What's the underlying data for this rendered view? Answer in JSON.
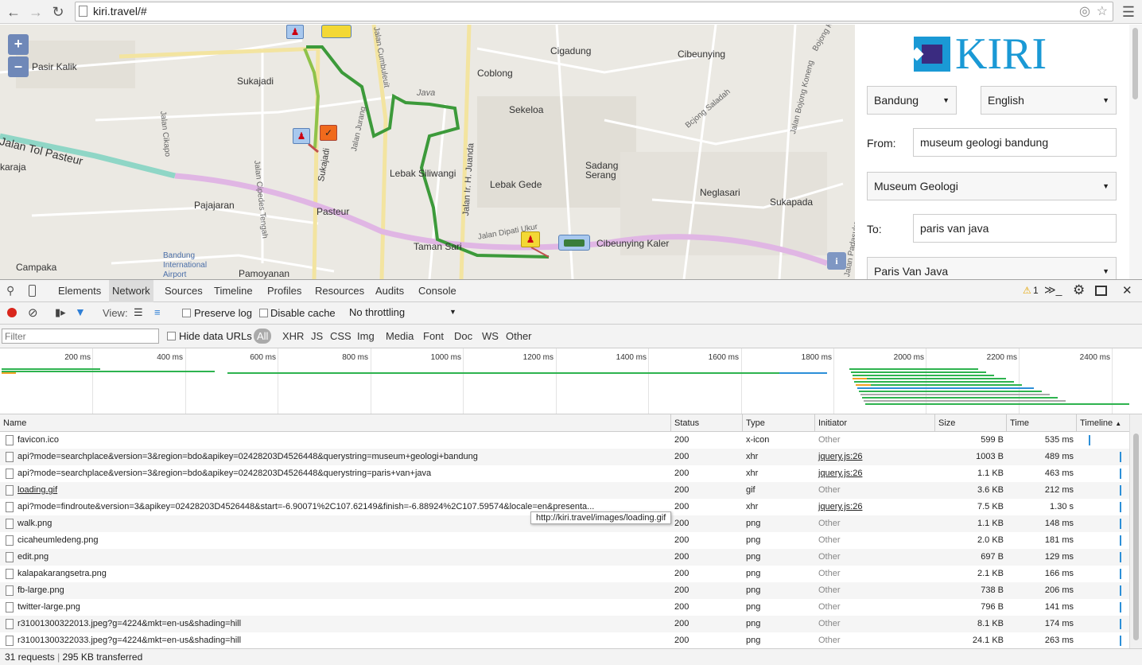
{
  "browser": {
    "url": "kiri.travel/#"
  },
  "map": {
    "labels": [
      {
        "text": "Pasir Kalik"
      },
      {
        "text": "Sukajadi"
      },
      {
        "text": "Cigadung"
      },
      {
        "text": "Cibeunying"
      },
      {
        "text": "Coblong"
      },
      {
        "text": "Sekeloa"
      },
      {
        "text": "Java"
      },
      {
        "text": "Jalan Tol Pasteur"
      },
      {
        "text": "karaja"
      },
      {
        "text": "Lebak Siliwangi"
      },
      {
        "text": "Lebak Gede"
      },
      {
        "text": "Sadang"
      },
      {
        "text": "Serang"
      },
      {
        "text": "Neglasari"
      },
      {
        "text": "Sukapada"
      },
      {
        "text": "Pajajaran"
      },
      {
        "text": "Pasteur"
      },
      {
        "text": "Cibeunying Kaler"
      },
      {
        "text": "Campaka"
      },
      {
        "text": "Bandung"
      },
      {
        "text": "International"
      },
      {
        "text": "Airport"
      },
      {
        "text": "Taman Sari"
      },
      {
        "text": "Pamoyanan"
      }
    ],
    "street_labels": [
      "Jalan Cumbuleuit",
      "Jalan Jurang",
      "Sukajadi",
      "Jalan Cipedes Tengah",
      "Jalan Cikapo",
      "Jalan Ir. H. Juanda",
      "Jalan Dipati Ukur",
      "Bojong Koneng",
      "Jalan Bojong Koneng",
      "Bcjong Saladah",
      "Jalan Padasuka"
    ],
    "zoom_in": "+",
    "zoom_out": "–",
    "info_icon": "i",
    "colors": {
      "route_green": "#3c9a3a",
      "route_lightgreen": "#8fc24a",
      "toll_road": "#8fd6c6",
      "main_road": "#e2b8e6",
      "minor_road": "#ffffff",
      "yellow_road": "#f6e7a2"
    }
  },
  "panel": {
    "logo_text": "KIRI",
    "city": "Bandung",
    "language": "English",
    "from_label": "From:",
    "from_value": "museum geologi bandung",
    "from_result": "Museum Geologi",
    "to_label": "To:",
    "to_value": "paris van java",
    "to_result": "Paris Van Java",
    "brand_color": "#1a99d5",
    "logo_dark": "#3a2b80"
  },
  "devtools": {
    "tabs": [
      "Elements",
      "Network",
      "Sources",
      "Timeline",
      "Profiles",
      "Resources",
      "Audits",
      "Console"
    ],
    "active_tab": "Network",
    "warning_count": "1",
    "view_label": "View:",
    "preserve_log": "Preserve log",
    "disable_cache": "Disable cache",
    "throttling": "No throttling",
    "filter_placeholder": "Filter",
    "hide_data_urls": "Hide data URLs",
    "types": [
      "All",
      "XHR",
      "JS",
      "CSS",
      "Img",
      "Media",
      "Font",
      "Doc",
      "WS",
      "Other"
    ],
    "ticks": [
      "200 ms",
      "400 ms",
      "600 ms",
      "800 ms",
      "1000 ms",
      "1200 ms",
      "1400 ms",
      "1600 ms",
      "1800 ms",
      "2000 ms",
      "2200 ms",
      "2400 ms"
    ],
    "columns": [
      "Name",
      "Status",
      "Type",
      "Initiator",
      "Size",
      "Time",
      "Timeline"
    ],
    "rows": [
      {
        "name": "favicon.ico",
        "status": "200",
        "type": "x-icon",
        "initiator": "Other",
        "size": "599 B",
        "time": "535 ms"
      },
      {
        "name": "api?mode=searchplace&version=3&region=bdo&apikey=02428203D4526448&querystring=museum+geologi+bandung",
        "status": "200",
        "type": "xhr",
        "initiator": "jquery.js:26",
        "size": "1003 B",
        "time": "489 ms"
      },
      {
        "name": "api?mode=searchplace&version=3&region=bdo&apikey=02428203D4526448&querystring=paris+van+java",
        "status": "200",
        "type": "xhr",
        "initiator": "jquery.js:26",
        "size": "1.1 KB",
        "time": "463 ms"
      },
      {
        "name": "loading.gif",
        "status": "200",
        "type": "gif",
        "initiator": "Other",
        "size": "3.6 KB",
        "time": "212 ms"
      },
      {
        "name": "api?mode=findroute&version=3&apikey=02428203D4526448&start=-6.90071%2C107.62149&finish=-6.88924%2C107.59574&locale=en&presenta...",
        "status": "200",
        "type": "xhr",
        "initiator": "jquery.js:26",
        "size": "7.5 KB",
        "time": "1.30 s"
      },
      {
        "name": "walk.png",
        "status": "200",
        "type": "png",
        "initiator": "Other",
        "size": "1.1 KB",
        "time": "148 ms"
      },
      {
        "name": "cicaheumledeng.png",
        "status": "200",
        "type": "png",
        "initiator": "Other",
        "size": "2.0 KB",
        "time": "181 ms"
      },
      {
        "name": "edit.png",
        "status": "200",
        "type": "png",
        "initiator": "Other",
        "size": "697 B",
        "time": "129 ms"
      },
      {
        "name": "kalapakarangsetra.png",
        "status": "200",
        "type": "png",
        "initiator": "Other",
        "size": "2.1 KB",
        "time": "166 ms"
      },
      {
        "name": "fb-large.png",
        "status": "200",
        "type": "png",
        "initiator": "Other",
        "size": "738 B",
        "time": "206 ms"
      },
      {
        "name": "twitter-large.png",
        "status": "200",
        "type": "png",
        "initiator": "Other",
        "size": "796 B",
        "time": "141 ms"
      },
      {
        "name": "r31001300322013.jpeg?g=4224&mkt=en-us&shading=hill",
        "status": "200",
        "type": "png",
        "initiator": "Other",
        "size": "8.1 KB",
        "time": "174 ms"
      },
      {
        "name": "r31001300322033.jpeg?g=4224&mkt=en-us&shading=hill",
        "status": "200",
        "type": "png",
        "initiator": "Other",
        "size": "24.1 KB",
        "time": "263 ms"
      }
    ],
    "tooltip": "http://kiri.travel/images/loading.gif",
    "status_requests": "31 requests",
    "status_transferred": "295 KB transferred"
  }
}
